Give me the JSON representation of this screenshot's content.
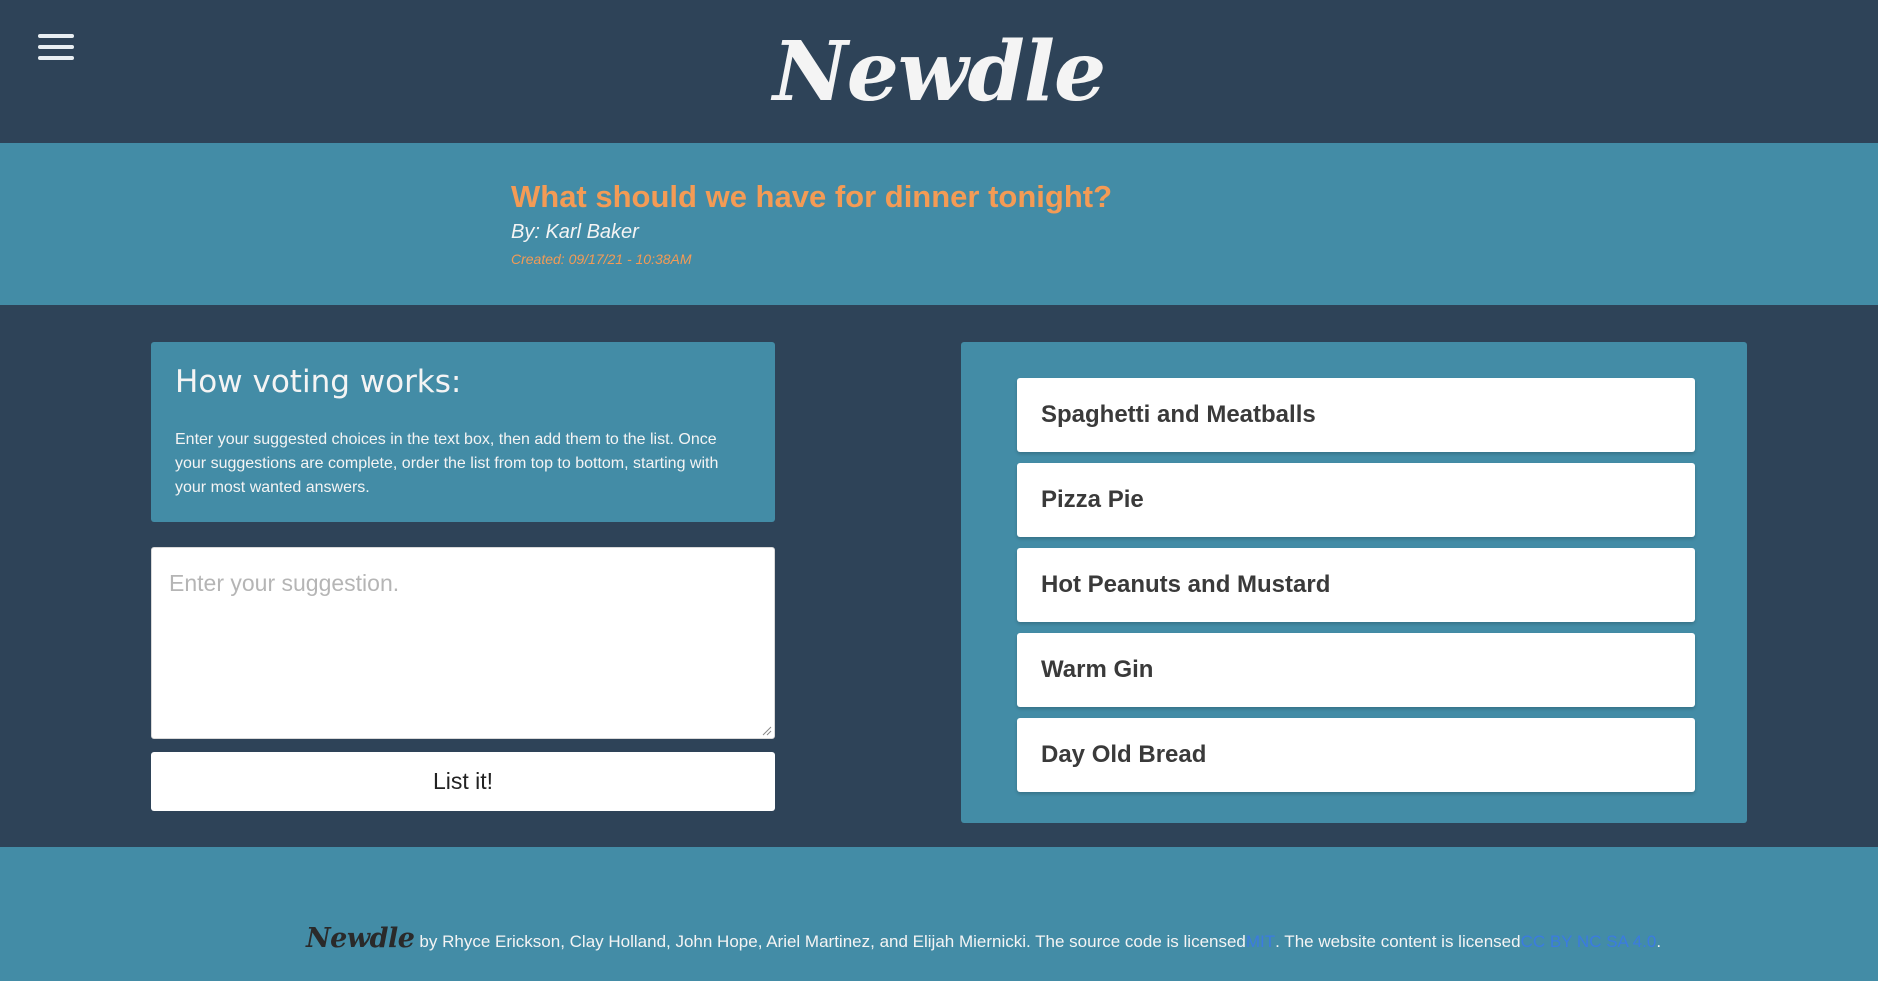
{
  "header": {
    "logo": "Newdle",
    "menu_icon": "hamburger-menu-icon"
  },
  "poll": {
    "title": "What should we have for dinner tonight?",
    "author": "By: Karl Baker",
    "created": "Created: 09/17/21 - 10:38AM"
  },
  "info": {
    "title": "How voting works:",
    "text": "Enter your suggested choices in the text box, then add them to the list. Once your suggestions are complete, order the list from top to bottom, starting with your most wanted answers."
  },
  "suggestion": {
    "placeholder": "Enter your suggestion.",
    "value": "",
    "button_label": "List it!"
  },
  "choices": [
    "Spaghetti and Meatballs",
    "Pizza Pie",
    "Hot Peanuts and Mustard",
    "Warm Gin",
    "Day Old Bread"
  ],
  "footer": {
    "logo": "Newdle",
    "credits": "by Rhyce Erickson, Clay Holland, John Hope, Ariel Martinez, and Elijah Miernicki. The source code is licensed ",
    "mit_link": "MIT",
    "middle": ". The website content is licensed ",
    "cc_link": "CC BY NC SA 4.0",
    "end": "."
  },
  "colors": {
    "header_bg": "#2e4358",
    "accent_bg": "#438ca6",
    "title_orange": "#f49b55",
    "link_blue": "#3b7be0"
  }
}
